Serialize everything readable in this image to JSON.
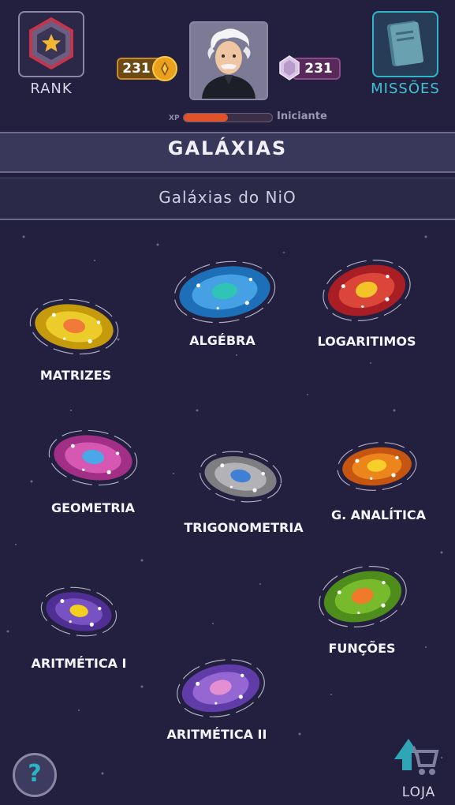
{
  "header": {
    "rank_label": "RANK",
    "missions_label": "MISSÕES",
    "coins": "231",
    "gems": "231",
    "xp_label": "XP",
    "xp_progress": 0.5,
    "level_name": "Iniciante"
  },
  "title": "GALÁXIAS",
  "subtitle": "Galáxias do NiO",
  "galaxies": [
    {
      "label": "ALGÉBRA",
      "icon": "galaxy-blue-icon",
      "outer": "#1d6fb8",
      "inner": "#4aa6e8",
      "core": "#2fc4b3"
    },
    {
      "label": "LOGARITIMOS",
      "icon": "galaxy-red-icon",
      "outer": "#a81e24",
      "inner": "#e14a3c",
      "core": "#f2c42a"
    },
    {
      "label": "MATRIZES",
      "icon": "galaxy-yellow-icon",
      "outer": "#c59a0d",
      "inner": "#f0d12e",
      "core": "#f07a3a"
    },
    {
      "label": "GEOMETRIA",
      "icon": "galaxy-pink-icon",
      "outer": "#a12f86",
      "inner": "#dd5db7",
      "core": "#4aa8e8"
    },
    {
      "label": "TRIGONOMETRIA",
      "icon": "galaxy-gray-icon",
      "outer": "#7d7d82",
      "inner": "#b9b9bd",
      "core": "#3f7fd6"
    },
    {
      "label": "G. ANALÍTICA",
      "icon": "galaxy-orange-icon",
      "outer": "#c55510",
      "inner": "#f08b1e",
      "core": "#f6cf2a"
    },
    {
      "label": "ARITMÉTICA I",
      "icon": "galaxy-purple-icon",
      "outer": "#4f2f94",
      "inner": "#7c57c6",
      "core": "#f3cf1e"
    },
    {
      "label": "FUNÇÕES",
      "icon": "galaxy-green-icon",
      "outer": "#4e8c1c",
      "inner": "#7cbf2e",
      "core": "#f07a2a"
    },
    {
      "label": "ARITMÉTICA II",
      "icon": "galaxy-violet-icon",
      "outer": "#5f3ca8",
      "inner": "#9b6cd6",
      "core": "#e48fd2"
    }
  ],
  "footer": {
    "help_symbol": "?",
    "shop_label": "LOJA"
  }
}
